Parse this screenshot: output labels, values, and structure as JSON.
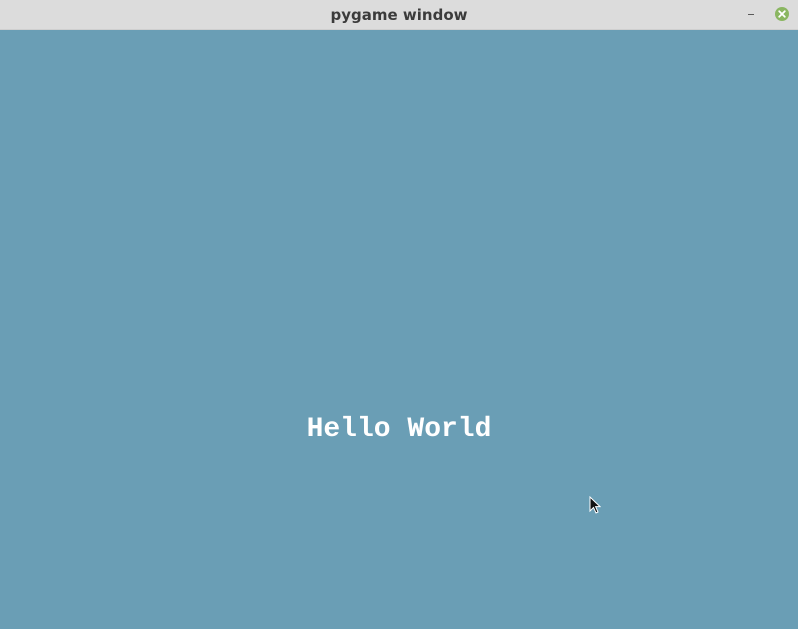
{
  "window": {
    "title": "pygame window"
  },
  "canvas": {
    "background_color": "#6a9eb5",
    "text": "Hello World",
    "text_color": "#ffffff"
  },
  "titlebar_buttons": {
    "minimize_icon": "minimize-icon",
    "close_icon": "close-icon",
    "close_color": "#8ab661"
  },
  "cursor": {
    "icon": "mouse-pointer-icon"
  }
}
